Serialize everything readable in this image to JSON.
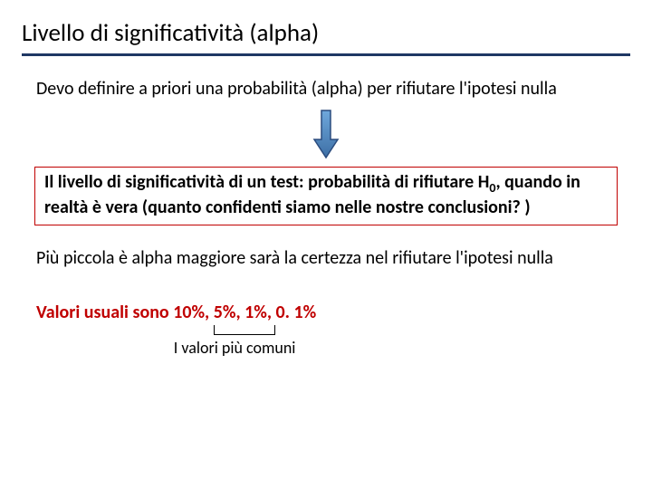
{
  "title": "Livello di significatività (alpha)",
  "line1": "Devo definire a priori una probabilità (alpha) per rifiutare l'ipotesi nulla",
  "boxed_a": "Il livello di significatività di un test: probabilità di rifiutare H",
  "boxed_b": ", quando in realtà è vera (quanto confidenti siamo nelle nostre conclusioni? )",
  "h0_sub": "0",
  "line3": "Più piccola è alpha maggiore sarà la certezza nel rifiutare l'ipotesi nulla",
  "line4_a": "Valori usuali sono 10%, ",
  "line4_b": "5%, 1%",
  "line4_c": ", 0. 1%",
  "caption1": "I valori più comuni"
}
